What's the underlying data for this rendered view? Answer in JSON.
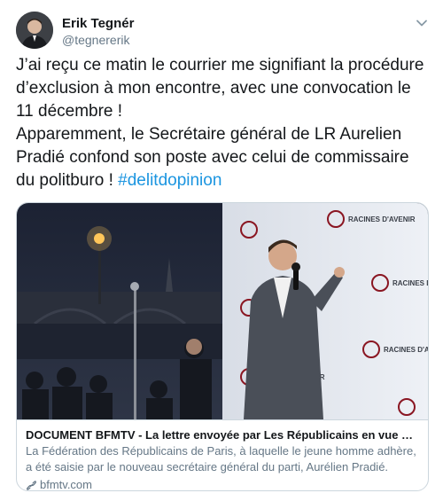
{
  "author": {
    "name": "Erik Tegnér",
    "handle": "@tegnererik"
  },
  "tweet": {
    "text_main": "J’ai reçu ce matin le courrier me signifiant la procédure d’exclusion à mon encontre, avec une convocation le 11 décembre !\nApparemment, le Secrétaire général de LR Aurelien Pradié confond son poste avec celui de commissaire du politburo ! ",
    "hashtag": "#delitdopinion"
  },
  "card": {
    "title": "DOCUMENT BFMTV - La lettre envoyée par Les Républicains en vue de l'exclu…",
    "description": "La Fédération des Républicains de Paris, à laquelle le jeune homme adhère, a été saisie par le nouveau secrétaire général du parti, Aurélien Pradié.",
    "domain": "bfmtv.com",
    "backdrop_text": "RACINES D'AVENIR"
  },
  "icons": {
    "caret": "chevron-down-icon",
    "link": "link-icon"
  },
  "colors": {
    "text": "#14171a",
    "secondary": "#657786",
    "link": "#1b95e0",
    "border": "#ccd6dd"
  }
}
